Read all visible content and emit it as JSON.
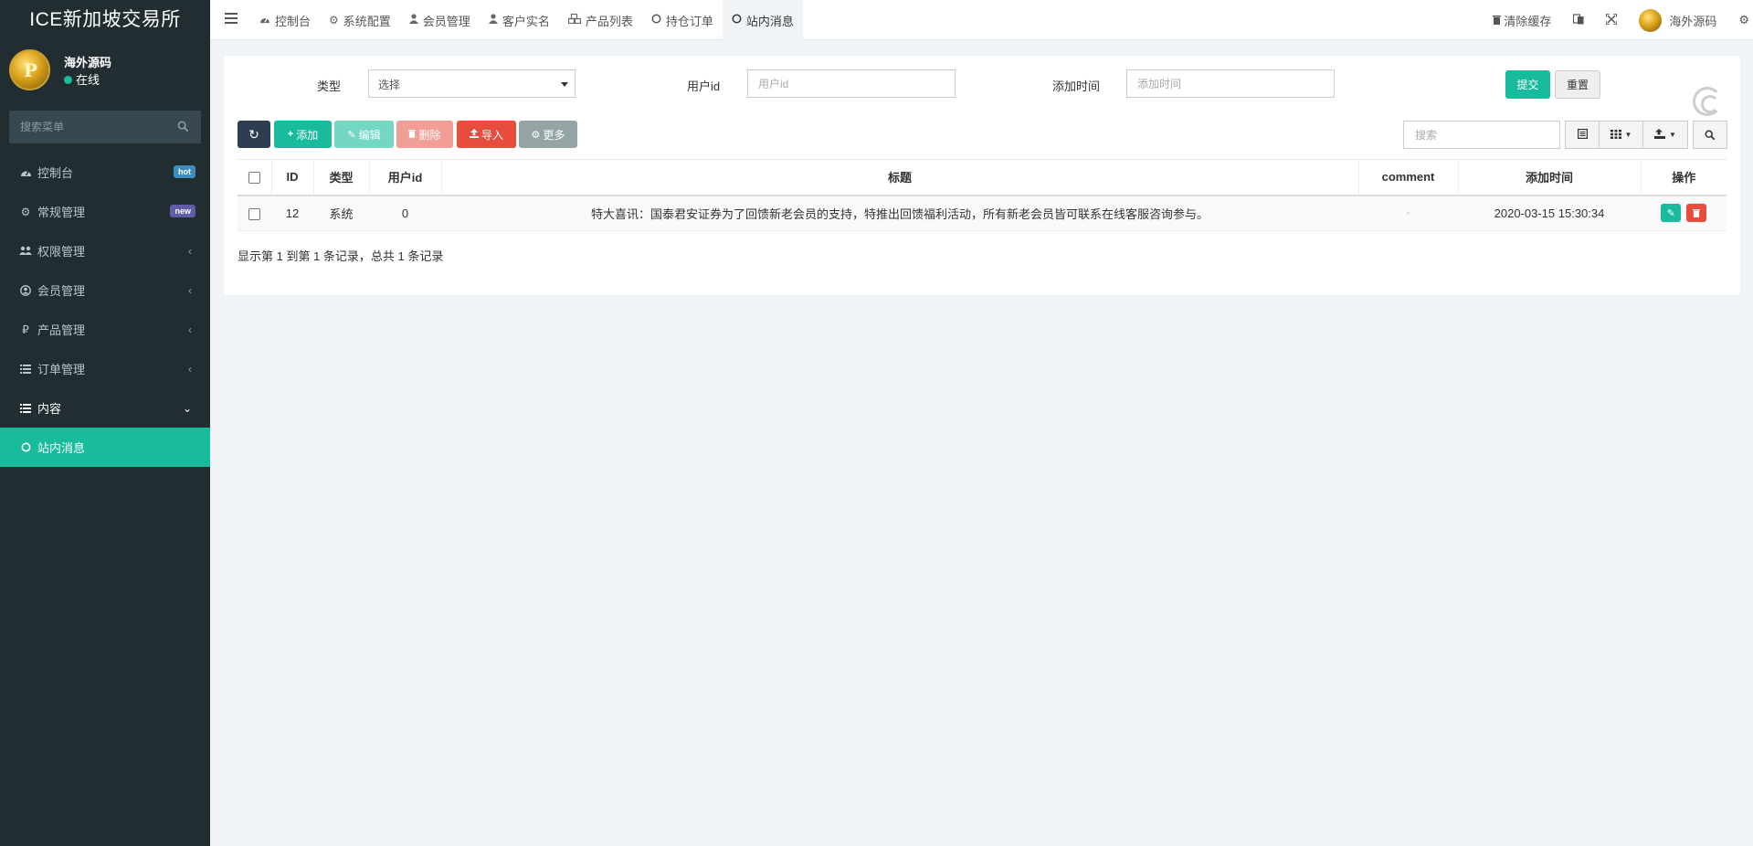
{
  "sidebar": {
    "brand": "ICE新加坡交易所",
    "user": {
      "name": "海外源码",
      "status": "在线"
    },
    "search_placeholder": "搜索菜单",
    "items": [
      {
        "label": "控制台",
        "icon": "dashboard-icon",
        "badge": "hot"
      },
      {
        "label": "常规管理",
        "icon": "cogs-icon",
        "badge": "new"
      },
      {
        "label": "权限管理",
        "icon": "group-icon"
      },
      {
        "label": "会员管理",
        "icon": "user-circle-icon"
      },
      {
        "label": "产品管理",
        "icon": "ruble-icon"
      },
      {
        "label": "订单管理",
        "icon": "list-icon"
      },
      {
        "label": "内容",
        "icon": "list-alt-icon"
      },
      {
        "label": "站内消息",
        "icon": "circle-o-icon"
      }
    ]
  },
  "navbar": {
    "tabs": [
      {
        "label": "控制台",
        "icon": "dashboard-icon"
      },
      {
        "label": "系统配置",
        "icon": "gear-icon"
      },
      {
        "label": "会员管理",
        "icon": "user-icon"
      },
      {
        "label": "客户实名",
        "icon": "user-icon"
      },
      {
        "label": "产品列表",
        "icon": "cubes-icon"
      },
      {
        "label": "持仓订单",
        "icon": "circle-o-icon"
      },
      {
        "label": "站内消息",
        "icon": "circle-o-icon"
      }
    ],
    "clear_cache": "清除缓存",
    "username": "海外源码"
  },
  "filters": {
    "type_label": "类型",
    "type_value": "选择",
    "userid_label": "用户id",
    "userid_placeholder": "用户id",
    "time_label": "添加时间",
    "time_placeholder": "添加时间",
    "submit": "提交",
    "reset": "重置"
  },
  "toolbar": {
    "add": "添加",
    "edit": "编辑",
    "delete": "删除",
    "import": "导入",
    "more": "更多",
    "search_placeholder": "搜索"
  },
  "table": {
    "headers": [
      "ID",
      "类型",
      "用户id",
      "标题",
      "comment",
      "添加时间",
      "操作"
    ],
    "rows": [
      {
        "id": "12",
        "type": "系统",
        "userid": "0",
        "title": "特大喜讯：国泰君安证券为了回馈新老会员的支持，特推出回馈福利活动，所有新老会员皆可联系在线客服咨询参与。",
        "comment": "-",
        "time": "2020-03-15 15:30:34"
      }
    ],
    "summary": "显示第 1 到第 1 条记录，总共 1 条记录"
  },
  "colors": {
    "accent": "#18bc9c",
    "sidebar": "#222d32",
    "danger": "#e74c3c",
    "dark": "#2c3e50"
  }
}
